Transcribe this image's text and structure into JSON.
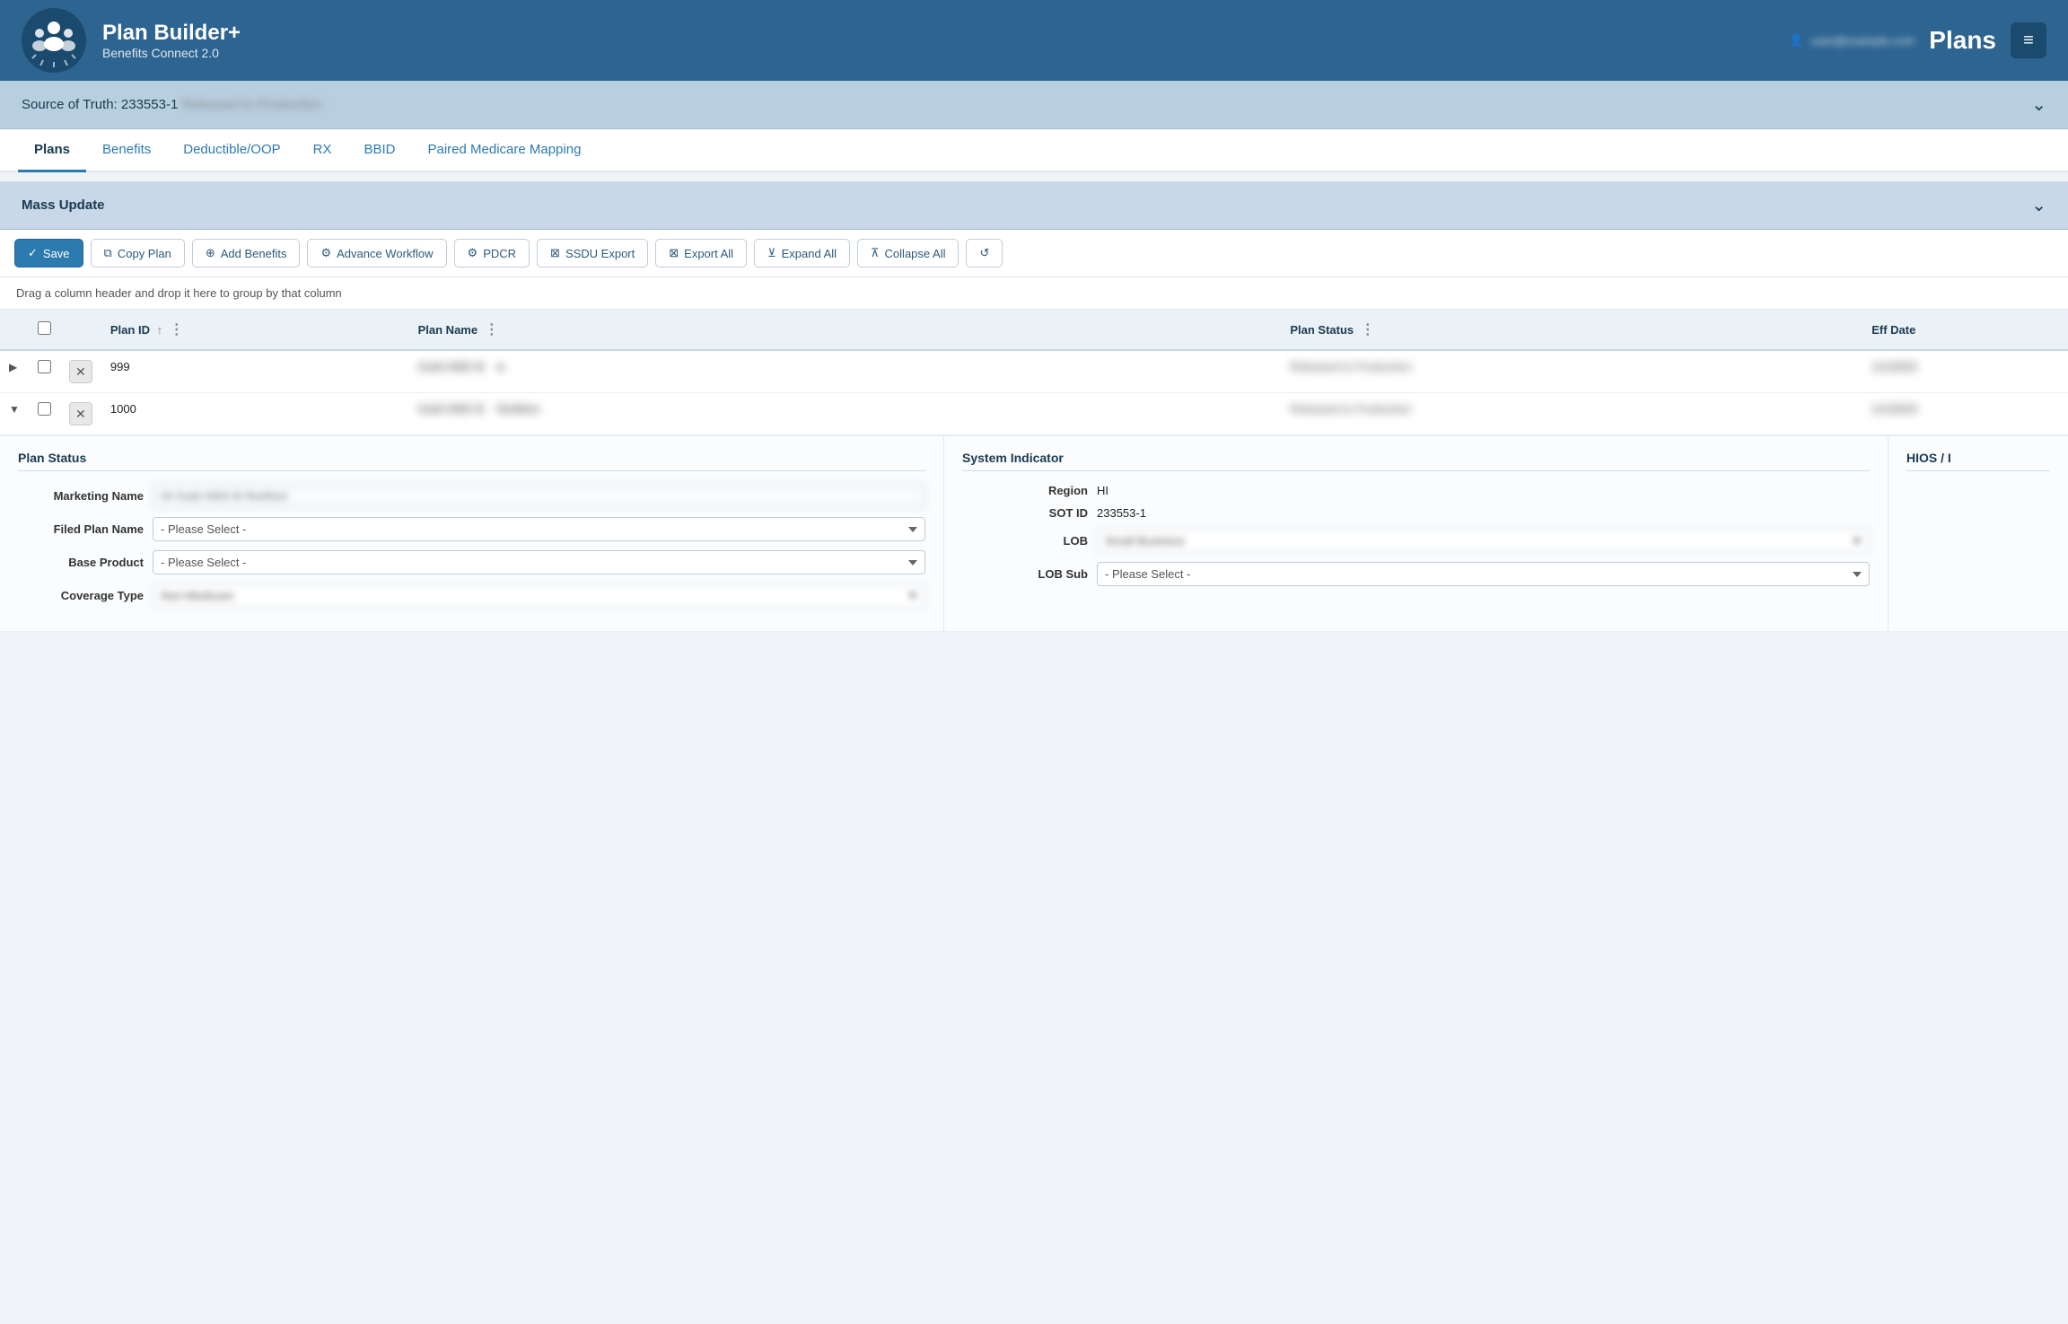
{
  "header": {
    "app_name": "Plan Builder+",
    "subtitle": "Benefits Connect 2.0",
    "section_label": "Plans",
    "user_email": "user@example.com"
  },
  "sot_bar": {
    "label": "Source of Truth: 233553-1",
    "status": "Released to Production"
  },
  "tabs": [
    {
      "id": "plans",
      "label": "Plans",
      "active": true
    },
    {
      "id": "benefits",
      "label": "Benefits",
      "active": false
    },
    {
      "id": "deductible",
      "label": "Deductible/OOP",
      "active": false
    },
    {
      "id": "rx",
      "label": "RX",
      "active": false
    },
    {
      "id": "bbid",
      "label": "BBID",
      "active": false
    },
    {
      "id": "paired",
      "label": "Paired Medicare Mapping",
      "active": false
    }
  ],
  "mass_update": {
    "label": "Mass Update"
  },
  "toolbar": {
    "save": "Save",
    "copy_plan": "Copy Plan",
    "add_benefits": "Add Benefits",
    "advance_workflow": "Advance Workflow",
    "pdcr": "PDCR",
    "ssdu_export": "SSDU Export",
    "export_all": "Export All",
    "expand_all": "Expand All",
    "collapse_all": "Collapse All",
    "refresh": "Refresh"
  },
  "drag_hint": "Drag a column header and drop it here to group by that column",
  "table": {
    "columns": [
      {
        "id": "expand",
        "label": ""
      },
      {
        "id": "check",
        "label": ""
      },
      {
        "id": "delete",
        "label": ""
      },
      {
        "id": "plan_id",
        "label": "Plan ID"
      },
      {
        "id": "plan_name",
        "label": "Plan Name"
      },
      {
        "id": "plan_status",
        "label": "Plan Status"
      },
      {
        "id": "eff_date",
        "label": "Eff Date"
      }
    ],
    "rows": [
      {
        "id": "row-999",
        "expanded": false,
        "plan_id": "999",
        "plan_name": "Gold HMO B",
        "plan_status": "Released to Production",
        "eff_date": "1/1/2023"
      },
      {
        "id": "row-1000",
        "expanded": true,
        "plan_id": "1000",
        "plan_name": "Gold HMO B RedNon",
        "plan_status": "Released to Production",
        "eff_date": "1/1/2023"
      }
    ]
  },
  "detail": {
    "plan_status_section": {
      "title": "Plan Status",
      "fields": [
        {
          "label": "Marketing Name",
          "type": "text",
          "value": "HI Gold HMO B RedNon",
          "blurred": true
        },
        {
          "label": "Filed Plan Name",
          "type": "select",
          "value": "- Please Select -"
        },
        {
          "label": "Base Product",
          "type": "select",
          "value": "- Please Select -"
        },
        {
          "label": "Coverage Type",
          "type": "select",
          "value": "Non-Medicare",
          "blurred": true
        }
      ]
    },
    "system_indicator_section": {
      "title": "System Indicator",
      "fields": [
        {
          "label": "Region",
          "type": "plain",
          "value": "HI"
        },
        {
          "label": "SOT ID",
          "type": "plain",
          "value": "233553-1"
        },
        {
          "label": "LOB",
          "type": "select",
          "value": "Small Business",
          "blurred": true
        },
        {
          "label": "LOB Sub",
          "type": "select",
          "value": "- Please Select -"
        }
      ]
    },
    "hios_section": {
      "title": "HIOS / I",
      "fields": []
    }
  },
  "please_select_options": [
    "- Please Select -"
  ],
  "colors": {
    "header_bg": "#2d6490",
    "sot_bg": "#b8cfe0",
    "mass_update_bg": "#c8d8e8",
    "tab_active_color": "#1a3a50",
    "primary_btn": "#2d7ab0"
  }
}
